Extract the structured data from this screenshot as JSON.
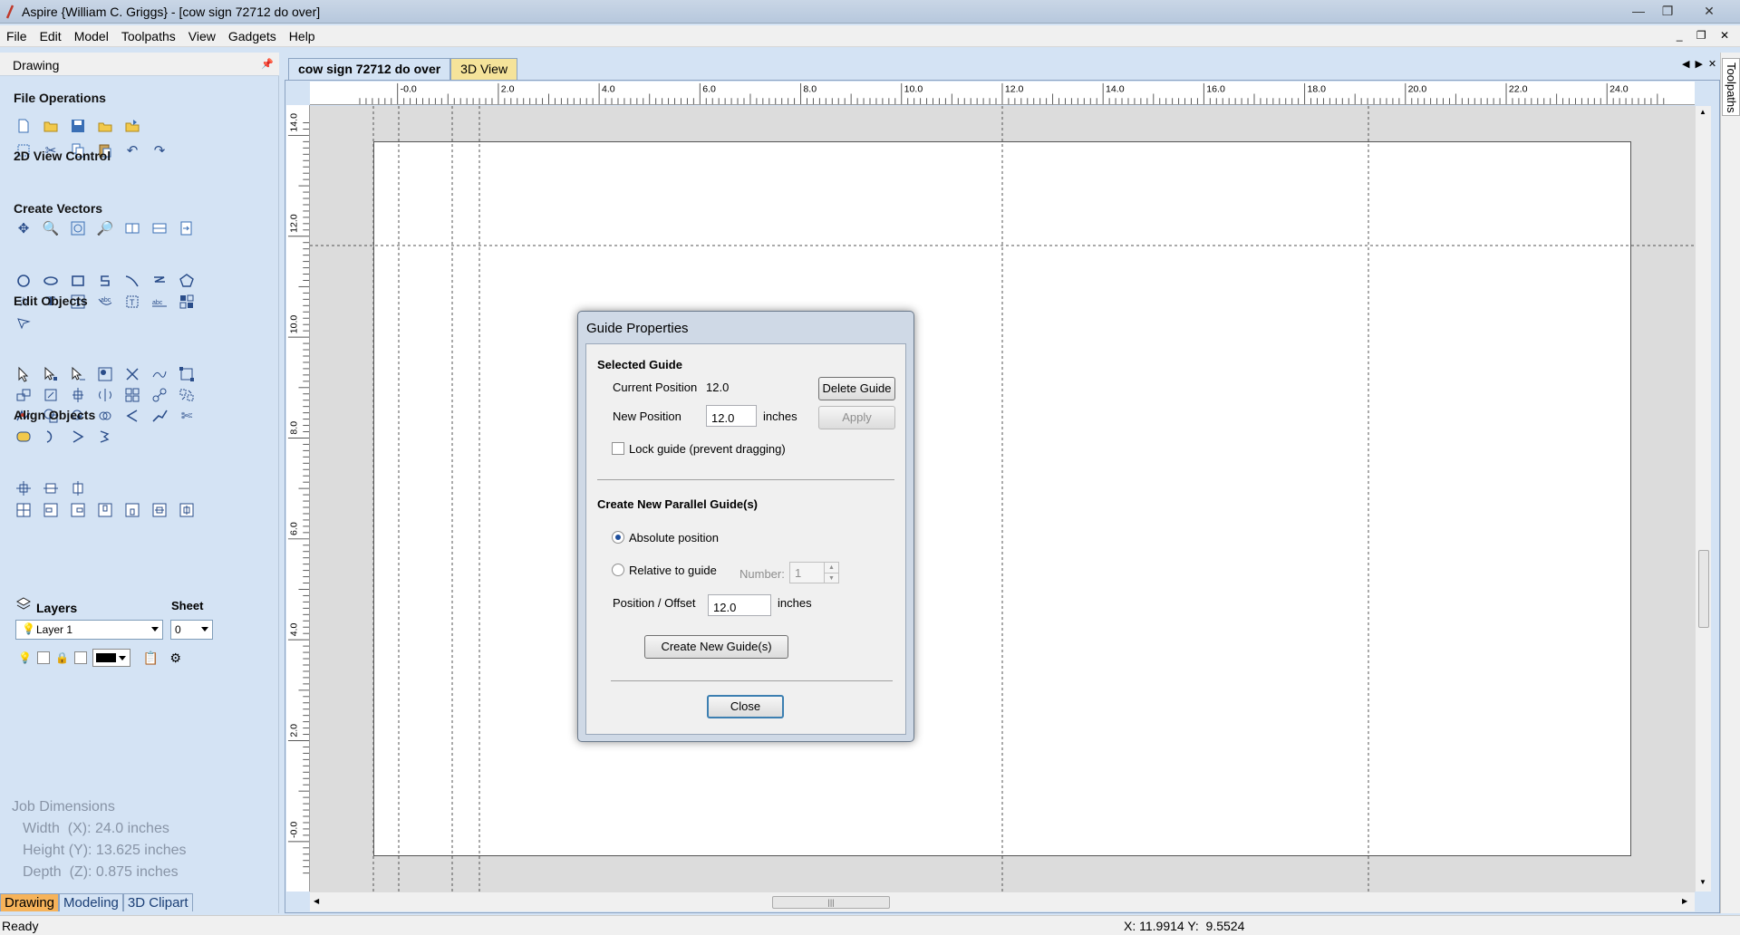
{
  "window": {
    "title": "Aspire {William C. Griggs} - [cow sign 72712 do over]"
  },
  "menu": [
    "File",
    "Edit",
    "Model",
    "Toolpaths",
    "View",
    "Gadgets",
    "Help"
  ],
  "panel": {
    "title": "Drawing",
    "sections": {
      "file_operations": "File Operations",
      "view_control": "2D View Control",
      "create_vectors": "Create Vectors",
      "edit_objects": "Edit Objects",
      "align_objects": "Align Objects"
    },
    "layers": {
      "label": "Layers",
      "sheet_label": "Sheet",
      "layer_value": "Layer 1",
      "sheet_value": "0"
    },
    "job_dimensions": {
      "title": "Job Dimensions",
      "width": "Width  (X): 24.0 inches",
      "height": "Height (Y): 13.625 inches",
      "depth": "Depth  (Z): 0.875 inches"
    },
    "bottom_tabs": [
      "Drawing",
      "Modeling",
      "3D Clipart"
    ]
  },
  "doc_tabs": [
    "cow sign 72712 do over",
    "3D View"
  ],
  "right_tab": "Toolpaths",
  "rulers": {
    "h_labels": [
      "-0.0",
      "2.0",
      "4.0",
      "6.0",
      "8.0",
      "10.0",
      "12.0",
      "14.0",
      "16.0",
      "18.0",
      "20.0",
      "22.0",
      "24.0"
    ],
    "v_labels": [
      "14.0",
      "12.0",
      "10.0",
      "8.0",
      "6.0",
      "4.0",
      "2.0",
      "-0.0"
    ]
  },
  "status": {
    "text": "Ready",
    "coords": "X: 11.9914 Y:  9.5524"
  },
  "dialog": {
    "title": "Guide Properties",
    "selected_guide": "Selected Guide",
    "current_position_label": "Current Position",
    "current_position_value": "12.0",
    "delete_button": "Delete Guide",
    "new_position_label": "New Position",
    "new_position_value": "12.0",
    "units": "inches",
    "apply_button": "Apply",
    "lock_label": "Lock guide (prevent dragging)",
    "parallel_header": "Create New Parallel Guide(s)",
    "absolute_label": "Absolute position",
    "relative_label": "Relative to guide",
    "number_label": "Number:",
    "number_value": "1",
    "offset_label": "Position / Offset",
    "offset_value": "12.0",
    "offset_units": "inches",
    "create_button": "Create New Guide(s)",
    "close_button": "Close"
  },
  "colors": {
    "panel_bg": "#d4e3f4",
    "active_tab": "#f6b35a",
    "inactive_doc_tab": "#f5e39a",
    "icon": "#2a4d8a"
  }
}
